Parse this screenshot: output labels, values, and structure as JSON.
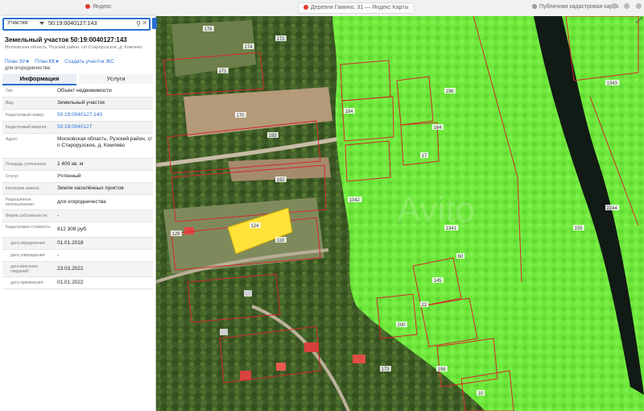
{
  "browser": {
    "tab_left": "Яндекс",
    "tab_mid": "Деревня Гамино, 31 — Яндекс Карты",
    "tab_right": "Публичная кадастровая карта"
  },
  "search": {
    "type": "Участки",
    "query": "50:19:0040127:143"
  },
  "object": {
    "title": "Земельный участок 50:19:0040127:143",
    "address_line": "Московская область, Рузский район, с/п Старорузское, д. Комлево",
    "links": [
      "План ЗУ",
      "План КК",
      "Создать участок ЖС"
    ],
    "purpose": "для огородничества"
  },
  "tabs": {
    "info": "Информация",
    "services": "Услуги"
  },
  "rows": [
    {
      "k": "Тип:",
      "v": "Объект недвижимости",
      "link": false
    },
    {
      "k": "Вид:",
      "v": "Земельный участок",
      "link": false
    },
    {
      "k": "Кадастровый номер:",
      "v": "50:19:0040127:143",
      "link": true
    },
    {
      "k": "Кадастровый квартал:",
      "v": "50:19:0040127",
      "link": true
    },
    {
      "k": "Адрес:",
      "v": "Московская область, Рузский район, с/п Старорузское, д. Комлево",
      "link": false
    },
    {
      "k": "Площадь уточненная:",
      "v": "1 400 кв. м",
      "link": false
    },
    {
      "k": "Статус:",
      "v": "Учтенный",
      "link": false
    },
    {
      "k": "Категория земель:",
      "v": "Земли населённых пунктов",
      "link": false
    },
    {
      "k": "Разрешенное использование:",
      "v": "для огородничества",
      "link": false
    },
    {
      "k": "Форма собственности:",
      "v": "-",
      "link": false
    },
    {
      "k": "Кадастровая стоимость:",
      "v": "812 308 руб.",
      "link": false
    },
    {
      "k": "дата определения:",
      "v": "01.01.2018",
      "link": false
    },
    {
      "k": "дата утверждения:",
      "v": "-",
      "link": false
    },
    {
      "k": "дата внесения сведений:",
      "v": "23.03.2022",
      "link": false
    },
    {
      "k": "дата применения:",
      "v": "01.01.2022",
      "link": false
    }
  ],
  "map": {
    "watermark": "Avito",
    "parcel_labels": [
      "176",
      "174",
      "172",
      "171",
      "170",
      "193",
      "192",
      "129",
      "124",
      "118",
      "184",
      "196",
      "164",
      "17",
      "60",
      "1042",
      "1341",
      "1343",
      "2244",
      "155",
      "145",
      "22",
      "200",
      "173",
      "198",
      "10"
    ]
  },
  "colors": {
    "accent": "#2a6fd3",
    "zone_green": "#6fe83b",
    "selected_parcel": "#ffe23a",
    "boundary": "#d22a2a"
  }
}
